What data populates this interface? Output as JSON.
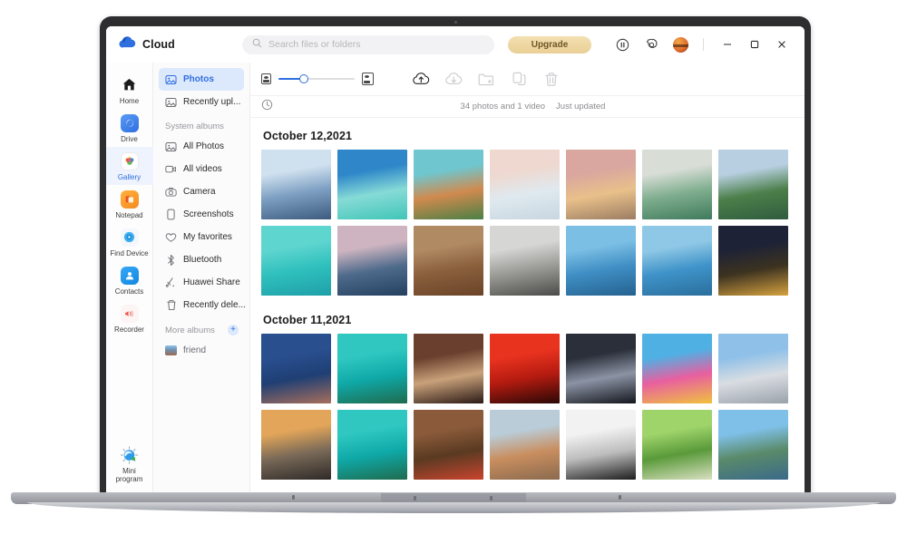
{
  "app": {
    "brand_name": "Cloud",
    "brand_icon": "cloud-icon"
  },
  "search": {
    "placeholder": "Search files or folders",
    "value": "",
    "icon": "search-icon"
  },
  "titlebar": {
    "upgrade_label": "Upgrade",
    "pause_icon": "pause-circle-icon",
    "settings_icon": "gear-icon",
    "avatar_icon": "avatar",
    "minimize_icon": "minimize-icon",
    "maximize_icon": "maximize-icon",
    "close_icon": "close-icon"
  },
  "rail": {
    "items": [
      {
        "label": "Home",
        "icon": "home-icon",
        "active": false
      },
      {
        "label": "Drive",
        "icon": "drive-icon",
        "active": false
      },
      {
        "label": "Gallery",
        "icon": "gallery-icon",
        "active": true
      },
      {
        "label": "Notepad",
        "icon": "notepad-icon",
        "active": false
      },
      {
        "label": "Find Device",
        "icon": "find-device-icon",
        "active": false
      },
      {
        "label": "Contacts",
        "icon": "contacts-icon",
        "active": false
      },
      {
        "label": "Recorder",
        "icon": "recorder-icon",
        "active": false
      }
    ],
    "bottom": {
      "label": "Mini program",
      "label_line1": "Mini",
      "label_line2": "program",
      "icon": "mini-program-icon"
    }
  },
  "albums": {
    "top_items": [
      {
        "label": "Photos",
        "icon": "photo-icon",
        "active": true
      },
      {
        "label": "Recently upl...",
        "icon": "photo-icon",
        "active": false
      }
    ],
    "system_header": "System albums",
    "system_items": [
      {
        "label": "All Photos",
        "icon": "photo-icon"
      },
      {
        "label": "All videos",
        "icon": "video-icon"
      },
      {
        "label": "Camera",
        "icon": "camera-icon"
      },
      {
        "label": "Screenshots",
        "icon": "screenshot-icon"
      },
      {
        "label": "My favorites",
        "icon": "heart-icon"
      },
      {
        "label": "Bluetooth",
        "icon": "bluetooth-icon"
      },
      {
        "label": "Huawei Share",
        "icon": "share-icon"
      },
      {
        "label": "Recently dele...",
        "icon": "trash-icon"
      }
    ],
    "more_header": "More albums",
    "add_icon": "plus-icon",
    "more_items": [
      {
        "label": "friend",
        "icon": "album-thumb"
      }
    ]
  },
  "toolbar": {
    "zoom_small_icon": "small-thumbnail-icon",
    "zoom_large_icon": "large-thumbnail-icon",
    "zoom_percent": 30,
    "tools": [
      {
        "name": "upload-icon",
        "label": "Upload"
      },
      {
        "name": "download-icon",
        "label": "Download"
      },
      {
        "name": "new-folder-icon",
        "label": "New folder"
      },
      {
        "name": "copy-icon",
        "label": "Copy"
      },
      {
        "name": "delete-icon",
        "label": "Delete"
      }
    ]
  },
  "statusbar": {
    "history_icon": "clock-icon",
    "count_text": "34 photos and 1 video",
    "sync_text": "Just updated"
  },
  "gallery": {
    "sections": [
      {
        "date": "October 12,2021",
        "rows": [
          [
            {
              "name": "mountain-lake-blue",
              "c1": "#cfe0ef",
              "c2": "#7c9ec1",
              "c3": "#3d5b7e"
            },
            {
              "name": "tropical-pier-resort",
              "c1": "#2f87c9",
              "c2": "#86dbd6",
              "c3": "#41c5b7"
            },
            {
              "name": "autumn-mountain-lake",
              "c1": "#6fc6cf",
              "c2": "#d08a4e",
              "c3": "#4b7f45"
            },
            {
              "name": "cloudscape-pastel",
              "c1": "#efd8cf",
              "c2": "#dfe9ef",
              "c3": "#c8d6e0"
            },
            {
              "name": "sunset-pier-train",
              "c1": "#d9a6a0",
              "c2": "#e8c08a",
              "c3": "#9c7d63"
            },
            {
              "name": "surfer-wave-green",
              "c1": "#d8ddd6",
              "c2": "#7fae8e",
              "c3": "#3f7a5c"
            },
            {
              "name": "aerial-river-forest",
              "c1": "#b7cfe0",
              "c2": "#4c7f4a",
              "c3": "#2f5c3e"
            }
          ],
          [
            {
              "name": "snorkeler-turquoise",
              "c1": "#5fd5d0",
              "c2": "#2fc0bd",
              "c3": "#1f9fa8"
            },
            {
              "name": "rocky-coast-dusk",
              "c1": "#cdb4c0",
              "c2": "#4f6b8c",
              "c3": "#23405f"
            },
            {
              "name": "desert-waterfall",
              "c1": "#b08a63",
              "c2": "#8a5f3c",
              "c3": "#6a4428"
            },
            {
              "name": "grey-shoreline-rocks",
              "c1": "#d6d6d4",
              "c2": "#9a9a96",
              "c3": "#4b4b48"
            },
            {
              "name": "winter-lake-mountains",
              "c1": "#7bbfe4",
              "c2": "#3f8ec4",
              "c3": "#24628f"
            },
            {
              "name": "mirror-lake-peaks",
              "c1": "#8fc8e6",
              "c2": "#3f93c9",
              "c3": "#2a6e9c"
            },
            {
              "name": "night-village-lights",
              "c1": "#1d2236",
              "c2": "#3c3220",
              "c3": "#d6a23f"
            }
          ]
        ]
      },
      {
        "date": "October 11,2021",
        "rows": [
          [
            {
              "name": "highway-interchange",
              "c1": "#2a4f8f",
              "c2": "#1f3f74",
              "c3": "#a86e5c"
            },
            {
              "name": "aerial-beach-island",
              "c1": "#2fc7c0",
              "c2": "#0fa9a8",
              "c3": "#1f6b4e"
            },
            {
              "name": "drummer-hands",
              "c1": "#6b3f2e",
              "c2": "#c9a17a",
              "c3": "#2a1a16"
            },
            {
              "name": "red-silhouette-singer",
              "c1": "#e8331f",
              "c2": "#b51b10",
              "c3": "#2a0806"
            },
            {
              "name": "concert-stage-bw",
              "c1": "#2b2f3a",
              "c2": "#8b93a4",
              "c3": "#14161d"
            },
            {
              "name": "color-festival-crowd",
              "c1": "#4fb0e4",
              "c2": "#e85fa0",
              "c3": "#f0c23f"
            },
            {
              "name": "skateboarder-ramp",
              "c1": "#8fc0e8",
              "c2": "#d9dde2",
              "c3": "#9aa2aa"
            }
          ],
          [
            {
              "name": "sunset-beach-rocks",
              "c1": "#e2a559",
              "c2": "#7a6a58",
              "c3": "#2e2a28"
            },
            {
              "name": "aerial-beach-island-2",
              "c1": "#2fc7c0",
              "c2": "#0fa9a8",
              "c3": "#1f6b4e"
            },
            {
              "name": "steak-board-food",
              "c1": "#8a5a3a",
              "c2": "#5a3a22",
              "c3": "#c9442e"
            },
            {
              "name": "hillside-city-view",
              "c1": "#b9ccd8",
              "c2": "#c98e5f",
              "c3": "#8a6a4e"
            },
            {
              "name": "bw-abstract-curves",
              "c1": "#f2f2f2",
              "c2": "#bdbdbd",
              "c3": "#1d1d1d"
            },
            {
              "name": "couple-picnic-park",
              "c1": "#9fd46a",
              "c2": "#5a9a3a",
              "c3": "#d8dfc0"
            },
            {
              "name": "coastal-city-aerial",
              "c1": "#7fc0e8",
              "c2": "#5a8a6a",
              "c3": "#3a6a8a"
            }
          ]
        ]
      }
    ]
  },
  "colors": {
    "accent": "#2f6fe0",
    "upgrade_bg": "#ecd095",
    "sidebar_active": "#dce8fb",
    "rail_active": "#eef3fd",
    "bezel": "#2e2e30"
  }
}
